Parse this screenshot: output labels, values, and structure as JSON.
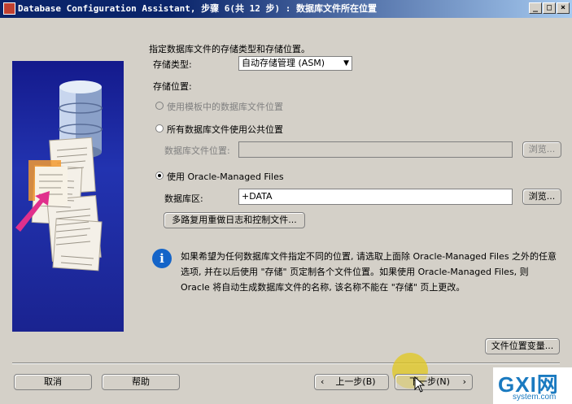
{
  "window": {
    "title": "Database Configuration Assistant, 步骤 6(共 12 步) : 数据库文件所在位置",
    "minimize": "_",
    "maximize": "□",
    "close": "×"
  },
  "form": {
    "heading": "指定数据库文件的存储类型和存储位置。",
    "storage_type_label": "存储类型:",
    "storage_type_value": "自动存储管理 (ASM)",
    "storage_location_label": "存储位置:",
    "option_template": "使用模板中的数据库文件位置",
    "option_common": "所有数据库文件使用公共位置",
    "db_file_location_label": "数据库文件位置:",
    "db_file_location_value": "",
    "option_omf": "使用 Oracle-Managed Files",
    "db_area_label": "数据库区:",
    "db_area_value": "+DATA",
    "browse": "浏览...",
    "multiplex_button": "多路复用重做日志和控制文件..."
  },
  "info": {
    "line1": "如果希望为任何数据库文件指定不同的位置, 请选取上面除 Oracle-Managed Files 之外的任意",
    "line2": "选项, 并在以后使用 \"存储\" 页定制各个文件位置。如果使用 Oracle-Managed Files, 则",
    "line3": "Oracle 将自动生成数据库文件的名称, 该名称不能在 \"存储\" 页上更改。"
  },
  "buttons": {
    "file_location_vars": "文件位置变量...",
    "cancel": "取消",
    "help": "帮助",
    "back": "上一步(B)",
    "next": "下一步(N)"
  },
  "watermark": {
    "brand": "GXI网",
    "site": "system.com"
  }
}
